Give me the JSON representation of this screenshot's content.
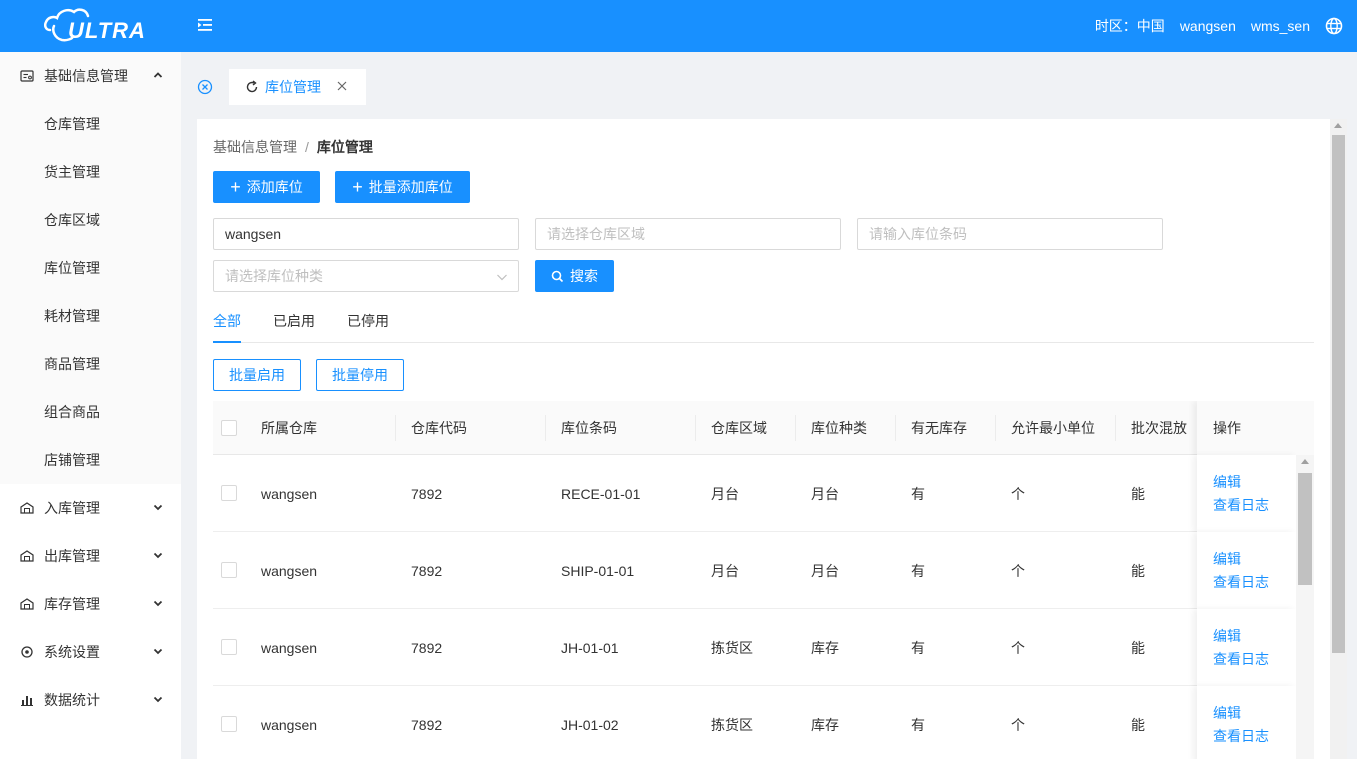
{
  "header": {
    "logo_text": "ULTRA",
    "timezone": "时区：中国",
    "username": "wangsen",
    "account": "wms_sen",
    "colors": {
      "primary": "#1890ff"
    }
  },
  "sidebar": {
    "groups": [
      {
        "label": "基础信息管理",
        "icon": "info-card-icon",
        "expanded": true,
        "items": [
          "仓库管理",
          "货主管理",
          "仓库区域",
          "库位管理",
          "耗材管理",
          "商品管理",
          "组合商品",
          "店铺管理"
        ]
      },
      {
        "label": "入库管理",
        "icon": "warehouse-in-icon",
        "expanded": false
      },
      {
        "label": "出库管理",
        "icon": "warehouse-out-icon",
        "expanded": false
      },
      {
        "label": "库存管理",
        "icon": "inventory-icon",
        "expanded": false
      },
      {
        "label": "系统设置",
        "icon": "settings-icon",
        "expanded": false
      },
      {
        "label": "数据统计",
        "icon": "bar-chart-icon",
        "expanded": false
      }
    ]
  },
  "tabs": {
    "active_tab": "库位管理"
  },
  "breadcrumb": {
    "parent": "基础信息管理",
    "separator": "/",
    "current": "库位管理"
  },
  "actions": {
    "add": "添加库位",
    "batch_add": "批量添加库位"
  },
  "filters": {
    "warehouse_value": "wangsen",
    "area_placeholder": "请选择仓库区域",
    "barcode_placeholder": "请输入库位条码",
    "type_placeholder": "请选择库位种类",
    "search_label": "搜索"
  },
  "status_tabs": [
    "全部",
    "已启用",
    "已停用"
  ],
  "batch": {
    "enable": "批量启用",
    "disable": "批量停用"
  },
  "table": {
    "columns": [
      "所属仓库",
      "仓库代码",
      "库位条码",
      "仓库区域",
      "库位种类",
      "有无库存",
      "允许最小单位",
      "批次混放",
      "操作"
    ],
    "rows": [
      {
        "warehouse": "wangsen",
        "code": "7892",
        "barcode": "RECE-01-01",
        "area": "月台",
        "type": "月台",
        "stock": "有",
        "unit": "个",
        "mix": "能"
      },
      {
        "warehouse": "wangsen",
        "code": "7892",
        "barcode": "SHIP-01-01",
        "area": "月台",
        "type": "月台",
        "stock": "有",
        "unit": "个",
        "mix": "能"
      },
      {
        "warehouse": "wangsen",
        "code": "7892",
        "barcode": "JH-01-01",
        "area": "拣货区",
        "type": "库存",
        "stock": "有",
        "unit": "个",
        "mix": "能"
      },
      {
        "warehouse": "wangsen",
        "code": "7892",
        "barcode": "JH-01-02",
        "area": "拣货区",
        "type": "库存",
        "stock": "有",
        "unit": "个",
        "mix": "能"
      }
    ],
    "op_edit": "编辑",
    "op_log": "查看日志"
  }
}
